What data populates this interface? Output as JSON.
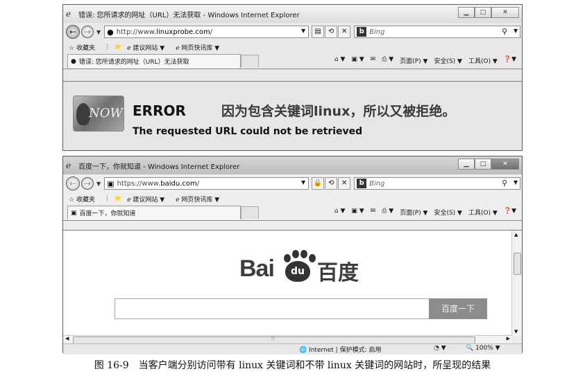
{
  "window1": {
    "title": "错误: 您所请求的网址（URL）无法获取 - Windows Internet Explorer",
    "url_prefix": "http://www.",
    "url_domain": "linuxprobe.com",
    "url_suffix": "/",
    "search_placeholder": "Bing",
    "tab_title": "错误: 您所请求的网址（URL）无法获取",
    "error_title": "ERROR",
    "error_note": "因为包含关键词linux，所以又被拒绝。",
    "error_message": "The requested URL could not be retrieved",
    "logo_text": "NOW"
  },
  "window2": {
    "title": "百度一下，你就知道 - Windows Internet Explorer",
    "url_prefix": "https://www.",
    "url_domain": "baidu.com",
    "url_suffix": "/",
    "search_placeholder": "Bing",
    "tab_title": "百度一下，你就知道",
    "logo_bai": "Bai",
    "logo_du": "du",
    "logo_cn": "百度",
    "search_button": "百度一下",
    "status_zone": "Internet | 保护模式: 启用",
    "zoom": "100%"
  },
  "favorites": {
    "label": "收藏夹",
    "suggested": "建议网站 ▼",
    "gallery": "网页快讯库 ▼"
  },
  "commandbar": {
    "page": "页面(P) ▼",
    "safety": "安全(S) ▼",
    "tools": "工具(O) ▼",
    "help": "❓▼"
  },
  "caption": "图 16-9　当客户端分别访问带有 linux 关键词和不带 linux 关键词的网站时，所呈现的结果"
}
